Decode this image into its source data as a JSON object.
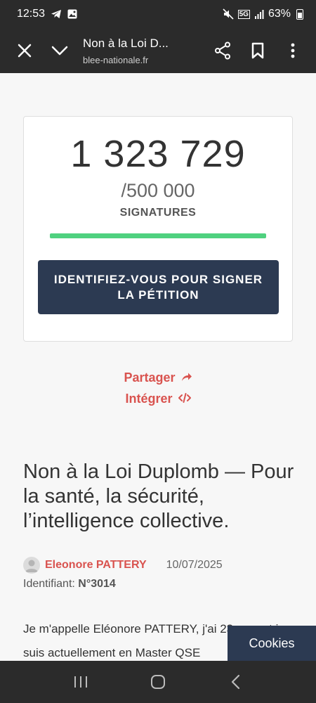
{
  "status_bar": {
    "time": "12:53",
    "battery": "63%",
    "network": "5G"
  },
  "browser": {
    "title": "Non à la Loi D...",
    "url": "blee-nationale.fr"
  },
  "petition": {
    "signature_count": "1 323 729",
    "goal": "/500 000",
    "signatures_label": "SIGNATURES",
    "progress_fraction": 1.0,
    "sign_button": "IDENTIFIEZ-VOUS POUR SIGNER LA PÉTITION",
    "share_label": "Partager",
    "embed_label": "Intégrer",
    "title": "Non à la Loi Duplomb — Pour la santé, la sécurité, l’intelligence collective.",
    "author": "Eleonore PATTERY",
    "date": "10/07/2025",
    "identifier_label": "Identifiant:",
    "identifier_value": "N°3014",
    "body": "Je m'appelle Eléonore PATTERY, j'ai 23 ans, et je suis actuellement en Master QSE"
  },
  "cookies_button": "Cookies",
  "colors": {
    "accent_red": "#d9534f",
    "button_navy": "#2c3a52",
    "progress_green": "#4fd17f",
    "dark_bar": "#2b2b2b"
  },
  "icons": [
    "telegram-icon",
    "gallery-icon",
    "mute-icon",
    "signal-icon",
    "battery-icon",
    "close-icon",
    "chevron-down-icon",
    "share-icon",
    "bookmark-icon",
    "more-icon",
    "share-arrow-icon",
    "code-icon",
    "avatar-icon",
    "recent-apps-icon",
    "home-icon",
    "back-icon"
  ]
}
